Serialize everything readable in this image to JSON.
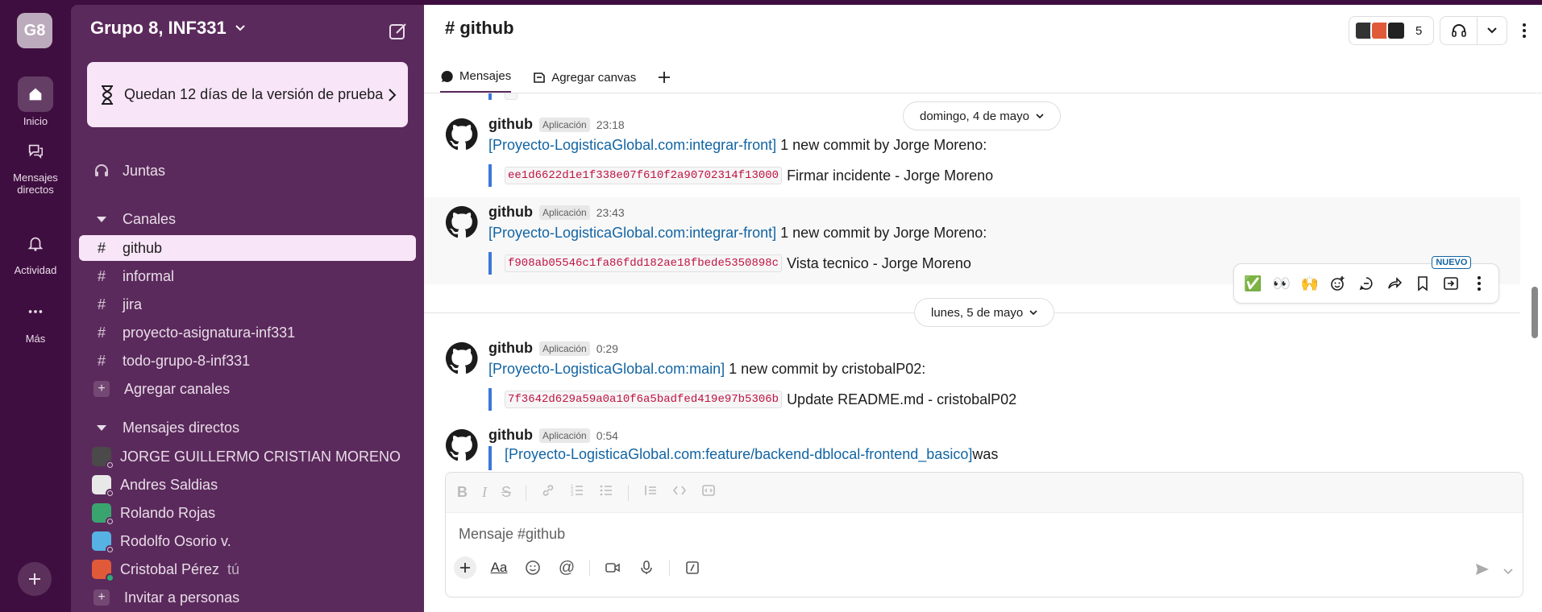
{
  "workspace": {
    "badge": "G8",
    "name": "Grupo 8, INF331"
  },
  "rail": [
    {
      "label": "Inicio",
      "icon": "home-icon"
    },
    {
      "label": "Mensajes directos",
      "icon": "dm-icon"
    },
    {
      "label": "Actividad",
      "icon": "bell-icon"
    },
    {
      "label": "Más",
      "icon": "more-icon"
    }
  ],
  "trial": {
    "text": "Quedan 12 días de la versión de prueba"
  },
  "sidebar": {
    "huddles": "Juntas",
    "channels_header": "Canales",
    "channels": [
      "github",
      "informal",
      "jira",
      "proyecto-asignatura-inf331",
      "todo-grupo-8-inf331"
    ],
    "add_channels": "Agregar canales",
    "dms_header": "Mensajes directos",
    "dms": [
      {
        "name": "JORGE GUILLERMO CRISTIAN MORENO",
        "color": "#4a4a4a"
      },
      {
        "name": "Andres Saldias",
        "color": "#e8e8e8"
      },
      {
        "name": "Rolando Rojas",
        "color": "#3aa46f"
      },
      {
        "name": "Rodolfo Osorio v.",
        "color": "#56b2e2"
      },
      {
        "name": "Cristobal Pérez",
        "color": "#e05a3a",
        "you": "tú"
      }
    ],
    "invite": "Invitar a personas"
  },
  "channel": {
    "title": "# github",
    "member_count": "5"
  },
  "tabs": {
    "messages": "Mensajes",
    "canvas": "Agregar canvas"
  },
  "dates": {
    "d1": "domingo, 4 de mayo",
    "d2": "lunes, 5 de mayo"
  },
  "messages": [
    {
      "name": "github",
      "badge": "Aplicación",
      "time": "23:18",
      "repo": "[Proyecto-LogisticaGlobal.com:integrar-front]",
      "text": " 1 new commit by Jorge Moreno:",
      "sha": "ee1d6622d1e1f338e07f610f2a90702314f13000",
      "commit": "Firmar incidente - Jorge Moreno"
    },
    {
      "name": "github",
      "badge": "Aplicación",
      "time": "23:43",
      "repo": "[Proyecto-LogisticaGlobal.com:integrar-front]",
      "text": " 1 new commit by Jorge Moreno:",
      "sha": "f908ab05546c1fa86fdd182ae18fbede5350898c",
      "commit": "Vista tecnico - Jorge Moreno"
    },
    {
      "name": "github",
      "badge": "Aplicación",
      "time": "0:29",
      "repo": "[Proyecto-LogisticaGlobal.com:main]",
      "text": " 1 new commit by cristobalP02:",
      "sha": "7f3642d629a59a0a10f6a5badfed419e97b5306b",
      "commit": "Update README.md - cristobalP02"
    },
    {
      "name": "github",
      "badge": "Aplicación",
      "time": "0:54",
      "repo": "[Proyecto-LogisticaGlobal.com:feature/backend-dblocal-frontend_basico]",
      "text": " was"
    }
  ],
  "actions_new": "NUEVO",
  "composer": {
    "placeholder": "Mensaje #github"
  }
}
